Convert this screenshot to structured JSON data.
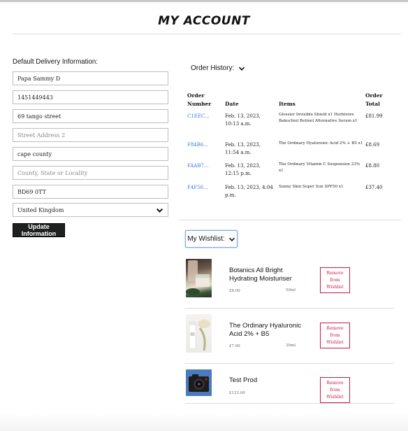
{
  "page": {
    "title": "MY ACCOUNT"
  },
  "delivery": {
    "heading": "Default Delivery Information:",
    "full_name": "Papa Sammy D",
    "phone": "1451449443",
    "street1": "69 tango street",
    "street2_placeholder": "Street Address 2",
    "town": "cape county",
    "county_placeholder": "County, State or Locality",
    "postcode": "BD69 0TT",
    "country": "United Kingdom",
    "update_label": "Update Information"
  },
  "orders": {
    "toggle_label": "Order History:",
    "headers": {
      "number": "Order Number",
      "date": "Date",
      "items": "Items",
      "total": "Order Total"
    },
    "rows": [
      {
        "number": "C1EEC...",
        "date": "Feb. 13, 2023, 10:13 a.m.",
        "items": "Glossier Invisible Shield x1 Herbivore Bakuchiol Retinol Alternative Serum x1",
        "total": "£81.99"
      },
      {
        "number": "F84B6...",
        "date": "Feb. 13, 2023, 11:54 a.m.",
        "items": "The Ordinary Hyaluronic Acid 2% + B5 x1",
        "total": "£8.69"
      },
      {
        "number": "FAAB7...",
        "date": "Feb. 13, 2023, 12:15 p.m.",
        "items": "The Ordinary Vitamin C Suspension 23% x1",
        "total": "£8.80"
      },
      {
        "number": "F4F56...",
        "date": "Feb. 13, 2023, 4:04 p.m.",
        "items": "Sunny Skin Super Sun SPF50 x1",
        "total": "£37.40"
      }
    ]
  },
  "wishlist": {
    "toggle_label": "My Wishlist:",
    "remove_label": "Remove from Wishlist",
    "items": [
      {
        "name": "Botanics All Bright Hydrating Moisturiser",
        "price": "£8.00",
        "size": "50ml"
      },
      {
        "name": "The Ordinary Hyaluronic Acid 2% + B5",
        "price": "£7.90",
        "size": "30ml"
      },
      {
        "name": "Test Prod",
        "price": "£123.00",
        "size": ""
      }
    ]
  },
  "icons": {
    "dropdown": "chevron-down-icon"
  },
  "colors": {
    "link": "#3e7cd8",
    "remove": "#c9184a",
    "button_bg": "#1f2120",
    "focus": "#7aa8e0"
  }
}
